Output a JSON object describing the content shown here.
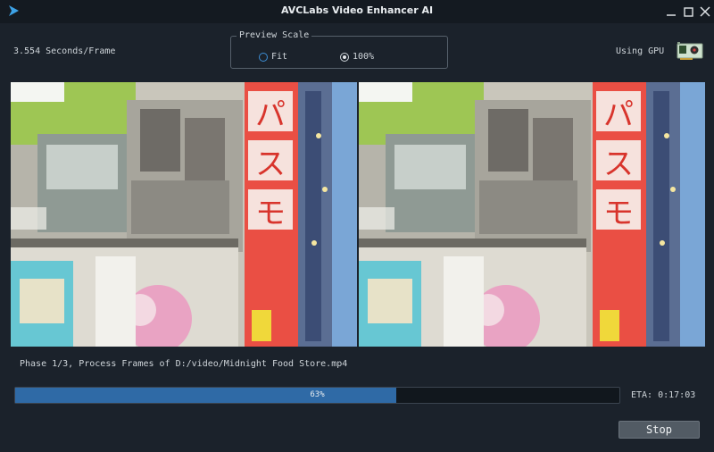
{
  "window": {
    "title": "AVCLabs Video Enhancer AI",
    "controls": [
      "minimize-icon",
      "maximize-icon",
      "close-icon"
    ]
  },
  "stats": {
    "speed": "3.554 Seconds/Frame",
    "gpu_label": "Using GPU"
  },
  "preview_scale": {
    "legend": "Preview Scale",
    "options": [
      {
        "label": "Fit",
        "selected": false
      },
      {
        "label": "100%",
        "selected": true
      }
    ]
  },
  "preview": {
    "sign_text": "パスモ"
  },
  "phase": "Phase 1/3, Process Frames of D:/video/Midnight Food Store.mp4",
  "progress": {
    "value": 63,
    "label": "63%"
  },
  "eta": "ETA: 0:17:03",
  "stop_label": "Stop",
  "colors": {
    "accent": "#2f6aa6",
    "background": "#1b222b",
    "titlebar": "#141a21"
  }
}
